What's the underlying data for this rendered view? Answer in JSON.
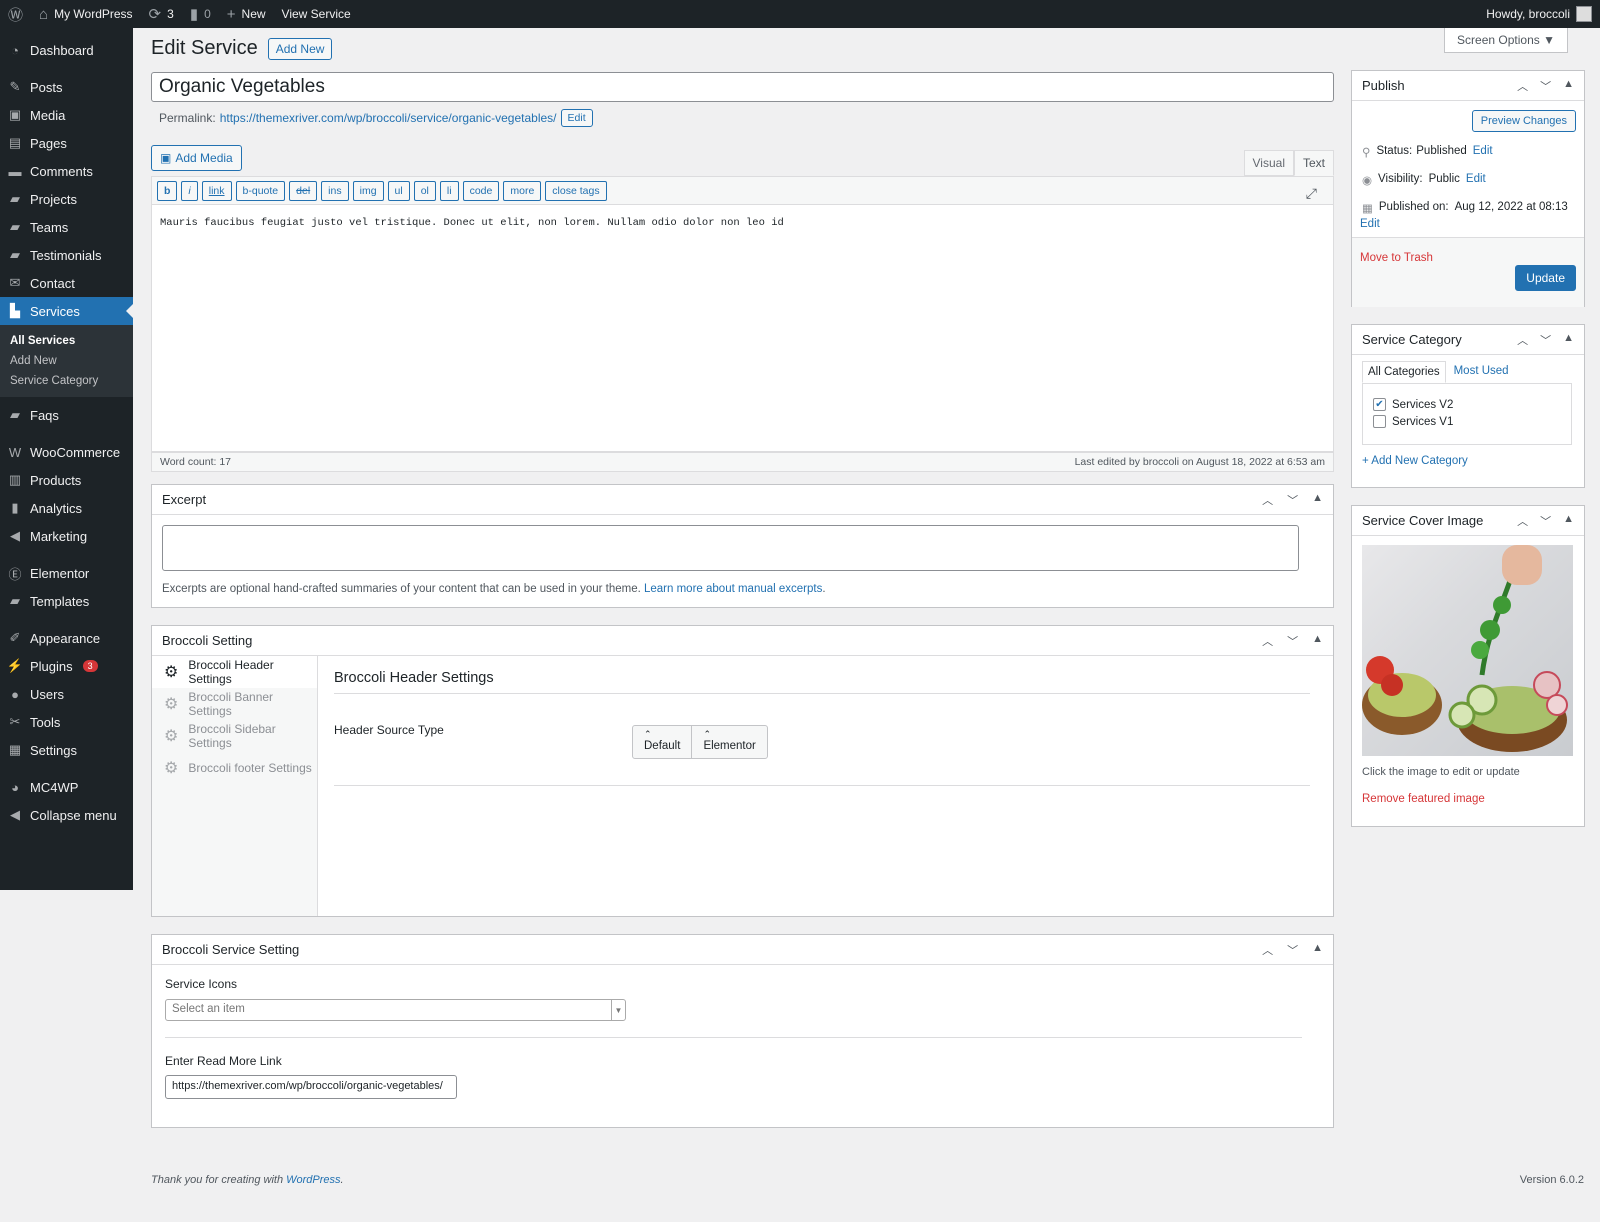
{
  "adminbar": {
    "site": "My WordPress",
    "updates": "3",
    "comments": "0",
    "new": "New",
    "view": "View Service",
    "howdy": "Howdy, broccoli"
  },
  "sidebar": {
    "items": [
      {
        "label": "Dashboard",
        "icon": "dashboard-icon"
      },
      {
        "label": "Posts",
        "icon": "pin-icon"
      },
      {
        "label": "Media",
        "icon": "media-icon"
      },
      {
        "label": "Pages",
        "icon": "page-icon"
      },
      {
        "label": "Comments",
        "icon": "comment-icon"
      },
      {
        "label": "Projects",
        "icon": "folder-icon"
      },
      {
        "label": "Teams",
        "icon": "folder-icon"
      },
      {
        "label": "Testimonials",
        "icon": "folder-icon"
      },
      {
        "label": "Contact",
        "icon": "mail-icon"
      },
      {
        "label": "Services",
        "icon": "briefcase-icon"
      },
      {
        "label": "Faqs",
        "icon": "folder-icon"
      },
      {
        "label": "WooCommerce",
        "icon": "woo-icon"
      },
      {
        "label": "Products",
        "icon": "archive-icon"
      },
      {
        "label": "Analytics",
        "icon": "chart-icon"
      },
      {
        "label": "Marketing",
        "icon": "megaphone-icon"
      },
      {
        "label": "Elementor",
        "icon": "elementor-icon"
      },
      {
        "label": "Templates",
        "icon": "folder-icon"
      },
      {
        "label": "Appearance",
        "icon": "brush-icon"
      },
      {
        "label": "Plugins",
        "icon": "plugin-icon",
        "badge": "3"
      },
      {
        "label": "Users",
        "icon": "user-icon"
      },
      {
        "label": "Tools",
        "icon": "wrench-icon"
      },
      {
        "label": "Settings",
        "icon": "settings-icon"
      },
      {
        "label": "MC4WP",
        "icon": "mc4wp-icon"
      },
      {
        "label": "Collapse menu",
        "icon": "collapse-icon"
      }
    ],
    "sub": [
      "All Services",
      "Add New",
      "Service Category"
    ]
  },
  "page": {
    "title": "Edit Service",
    "add_new": "Add New",
    "screen_options": "Screen Options"
  },
  "post": {
    "title": "Organic Vegetables",
    "permalink_label": "Permalink:",
    "permalink_base": "https://themexriver.com/wp/broccoli/service/",
    "permalink_slug": "organic-vegetables",
    "permalink_end": "/",
    "edit": "Edit"
  },
  "editor": {
    "add_media": "Add Media",
    "tab_visual": "Visual",
    "tab_text": "Text",
    "quicktags": [
      "b",
      "i",
      "link",
      "b-quote",
      "del",
      "ins",
      "img",
      "ul",
      "ol",
      "li",
      "code",
      "more",
      "close tags"
    ],
    "content": "Mauris faucibus feugiat justo vel tristique. Donec ut elit, non lorem. Nullam odio dolor non leo id",
    "word_count": "Word count: 17",
    "last_edited": "Last edited by broccoli on August 18, 2022 at 6:53 am"
  },
  "excerpt": {
    "title": "Excerpt",
    "help": "Excerpts are optional hand-crafted summaries of your content that can be used in your theme.",
    "link": "Learn more about manual excerpts",
    "end": "."
  },
  "broccoli": {
    "title": "Broccoli Setting",
    "tabs": [
      "Broccoli Header Settings",
      "Broccoli Banner Settings",
      "Broccoli Sidebar Settings",
      "Broccoli footer Settings"
    ],
    "panel_title": "Broccoli Header Settings",
    "field_label": "Header Source Type",
    "options": [
      "Default",
      "Elementor"
    ]
  },
  "service_setting": {
    "title": "Broccoli Service Setting",
    "icons_label": "Service Icons",
    "icons_placeholder": "Select an item",
    "link_label": "Enter Read More Link",
    "link_value": "https://themexriver.com/wp/broccoli/organic-vegetables/"
  },
  "publish": {
    "title": "Publish",
    "preview": "Preview Changes",
    "status_label": "Status:",
    "status": "Published",
    "visibility_label": "Visibility:",
    "visibility": "Public",
    "published_label": "Published on:",
    "published": "Aug 12, 2022 at 08:13",
    "edit": "Edit",
    "trash": "Move to Trash",
    "update": "Update"
  },
  "category": {
    "title": "Service Category",
    "tab_all": "All Categories",
    "tab_used": "Most Used",
    "items": [
      {
        "label": "Services V2",
        "checked": true
      },
      {
        "label": "Services V1",
        "checked": false
      }
    ],
    "add": "+ Add New Category"
  },
  "cover": {
    "title": "Service Cover Image",
    "help": "Click the image to edit or update",
    "remove": "Remove featured image"
  },
  "footer": {
    "thanks": "Thank you for creating with",
    "wp": "WordPress",
    "end": ".",
    "version": "Version 6.0.2"
  },
  "colors": {
    "accent": "#2271b1",
    "danger": "#d63638",
    "sidebar": "#1d2327"
  }
}
